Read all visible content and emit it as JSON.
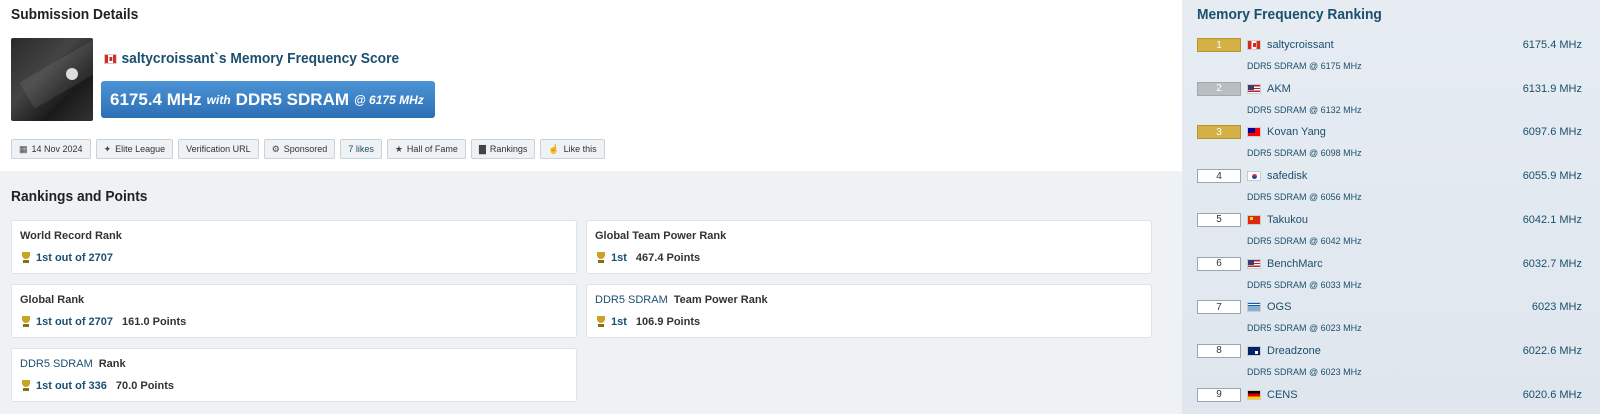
{
  "submission": {
    "section_title": "Submission Details",
    "country": "Canada",
    "title": "saltycroissant`s Memory Frequency Score",
    "score": "6175.4 MHz",
    "with": "with",
    "memory_type": "DDR5 SDRAM",
    "at_freq": "@ 6175 MHz",
    "tags": [
      {
        "icon": "calendar-icon",
        "glyph": "▦",
        "label": "14 Nov 2024",
        "link": false
      },
      {
        "icon": "league-icon",
        "glyph": "✦",
        "label": "Elite League",
        "link": false
      },
      {
        "icon": "",
        "glyph": "",
        "label": "Verification URL",
        "link": false
      },
      {
        "icon": "sponsored-icon",
        "glyph": "⚙",
        "label": "Sponsored",
        "link": false
      },
      {
        "icon": "",
        "glyph": "",
        "label": "7 likes",
        "link": true
      },
      {
        "icon": "star-icon",
        "glyph": "★",
        "label": "Hall of Fame",
        "link": false
      },
      {
        "icon": "chart-icon",
        "glyph": "▇",
        "label": "Rankings",
        "link": false
      },
      {
        "icon": "thumbs-up-icon",
        "glyph": "☝",
        "label": "Like this",
        "link": false
      }
    ]
  },
  "rankings": {
    "section_title": "Rankings and Points",
    "boxes": [
      {
        "label_prefix": "",
        "label": "World Record Rank",
        "position": "1st out of 2707",
        "points": ""
      },
      {
        "label_prefix": "",
        "label": "Global Team Power Rank",
        "position": "1st",
        "points": "467.4 Points"
      },
      {
        "label_prefix": "",
        "label": "Global Rank",
        "position": "1st out of 2707",
        "points": "161.0 Points"
      },
      {
        "label_prefix": "DDR5 SDRAM",
        "label": "Team Power Rank",
        "position": "1st",
        "points": "106.9 Points"
      },
      {
        "label_prefix": "DDR5 SDRAM",
        "label": "Rank",
        "position": "1st out of 336",
        "points": "70.0 Points"
      }
    ]
  },
  "sidebar": {
    "title": "Memory Frequency Ranking",
    "entries": [
      {
        "rank": "1",
        "medal": "gold",
        "flag": "ca",
        "name": "saltycroissant",
        "score": "6175.4 MHz",
        "sub": "DDR5 SDRAM @ 6175 MHz"
      },
      {
        "rank": "2",
        "medal": "silver",
        "flag": "us",
        "name": "AKM",
        "score": "6131.9 MHz",
        "sub": "DDR5 SDRAM @ 6132 MHz"
      },
      {
        "rank": "3",
        "medal": "gold",
        "flag": "tw",
        "name": "Kovan Yang",
        "score": "6097.6 MHz",
        "sub": "DDR5 SDRAM @ 6098 MHz"
      },
      {
        "rank": "4",
        "medal": "",
        "flag": "kr",
        "name": "safedisk",
        "score": "6055.9 MHz",
        "sub": "DDR5 SDRAM @ 6056 MHz"
      },
      {
        "rank": "5",
        "medal": "",
        "flag": "cn",
        "name": "Takukou",
        "score": "6042.1 MHz",
        "sub": "DDR5 SDRAM @ 6042 MHz"
      },
      {
        "rank": "6",
        "medal": "",
        "flag": "us",
        "name": "BenchMarc",
        "score": "6032.7 MHz",
        "sub": "DDR5 SDRAM @ 6033 MHz"
      },
      {
        "rank": "7",
        "medal": "",
        "flag": "gr",
        "name": "OGS",
        "score": "6023 MHz",
        "sub": "DDR5 SDRAM @ 6023 MHz"
      },
      {
        "rank": "8",
        "medal": "",
        "flag": "au",
        "name": "Dreadzone",
        "score": "6022.6 MHz",
        "sub": "DDR5 SDRAM @ 6023 MHz"
      },
      {
        "rank": "9",
        "medal": "",
        "flag": "de",
        "name": "CENS",
        "score": "6020.6 MHz",
        "sub": ""
      }
    ]
  }
}
